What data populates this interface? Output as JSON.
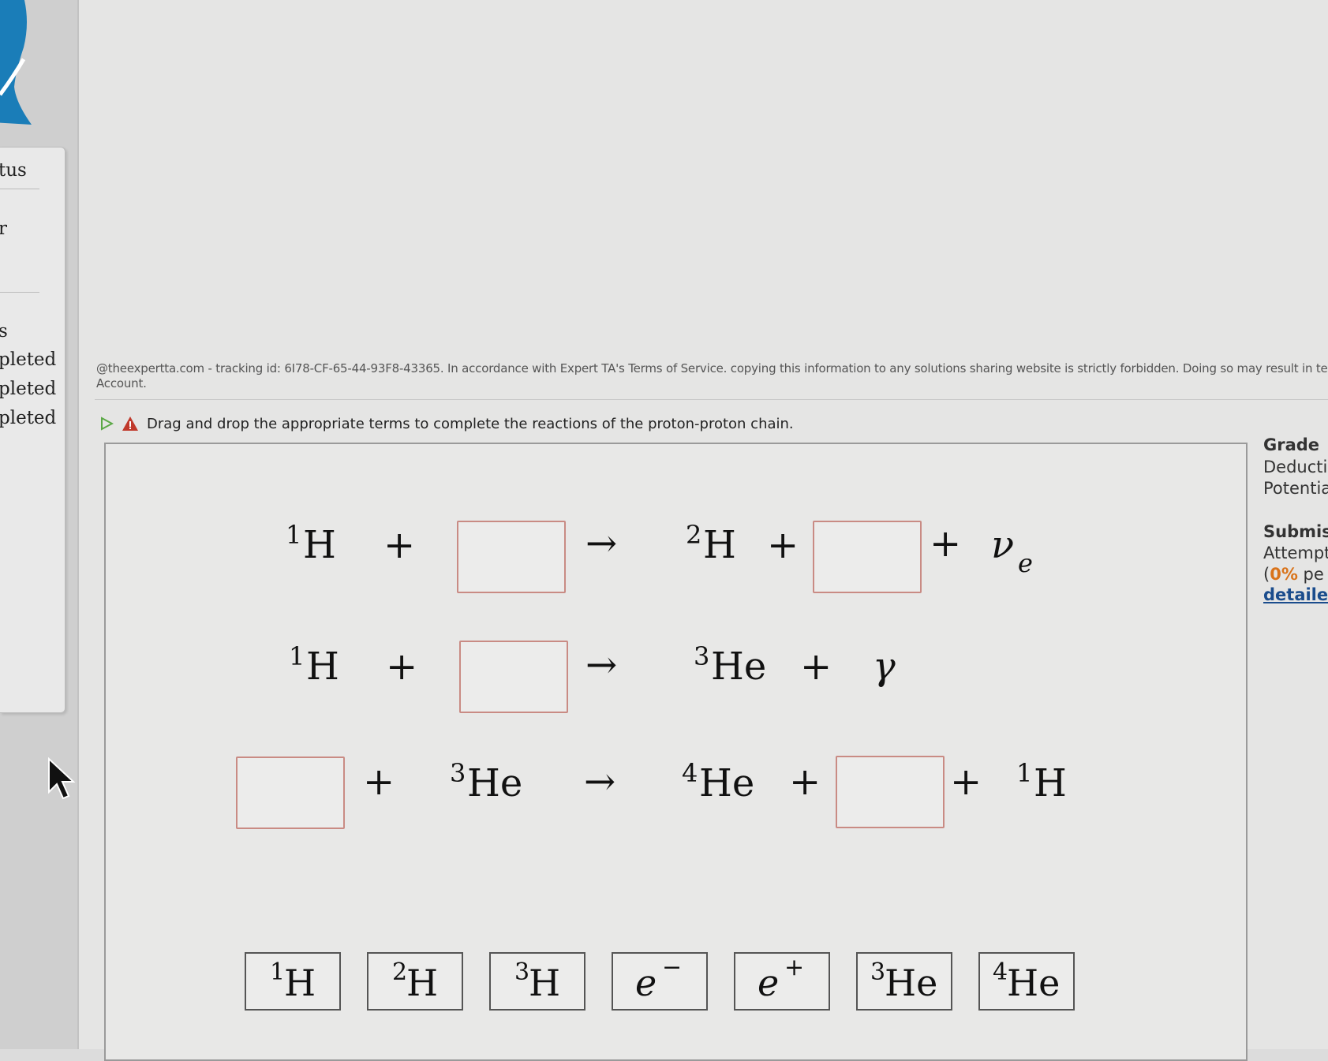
{
  "sidebar": {
    "header_partial": "tus",
    "mark_partial": "r",
    "section_partial": "s",
    "items": [
      "pleted",
      "pleted",
      "pleted"
    ]
  },
  "notice": {
    "line1": "@theexpertta.com - tracking id: 6I78-CF-65-44-93F8-43365. In accordance with Expert TA's Terms of Service. copying this information to any solutions sharing website is strictly forbidden. Doing so may result in termina",
    "line2": "Account."
  },
  "prompt": {
    "text": "Drag and drop the appropriate terms to complete the reactions of the proton-proton chain."
  },
  "equations": {
    "plus": "+",
    "arrow": "→",
    "row1": {
      "r1_sup": "1",
      "r1_sym": "H",
      "p1_sup": "2",
      "p1_sym": "H",
      "p3_sym": "ν",
      "p3_sub": "e"
    },
    "row2": {
      "r1_sup": "1",
      "r1_sym": "H",
      "p1_sup": "3",
      "p1_sym": "He",
      "p2_sym": "γ"
    },
    "row3": {
      "r2_sup": "3",
      "r2_sym": "He",
      "p1_sup": "4",
      "p1_sym": "He",
      "p3_sup": "1",
      "p3_sym": "H"
    }
  },
  "tiles": [
    {
      "sup": "1",
      "sym": "H"
    },
    {
      "sup": "2",
      "sym": "H"
    },
    {
      "sup": "3",
      "sym": "H"
    },
    {
      "sym": "e",
      "charge": "−"
    },
    {
      "sym": "e",
      "charge": "+"
    },
    {
      "sup": "3",
      "sym": "He"
    },
    {
      "sup": "4",
      "sym": "He"
    }
  ],
  "grade_panel": {
    "grade_label": "Grade",
    "deduction_label": "Deducti",
    "potential_label": "Potentia",
    "submissions_label": "Submis",
    "attempts_label": "Attempt",
    "percent_open": "(",
    "percent_value": "0%",
    "percent_rest": " pe",
    "detailed_link": "detailed"
  },
  "colors": {
    "drop_border": "#c98b84",
    "warning_red": "#c0392b",
    "play_green": "#5aa845",
    "percent_orange": "#d9731a",
    "link_blue": "#1a4c8c",
    "logo_blue": "#1a7db8"
  }
}
